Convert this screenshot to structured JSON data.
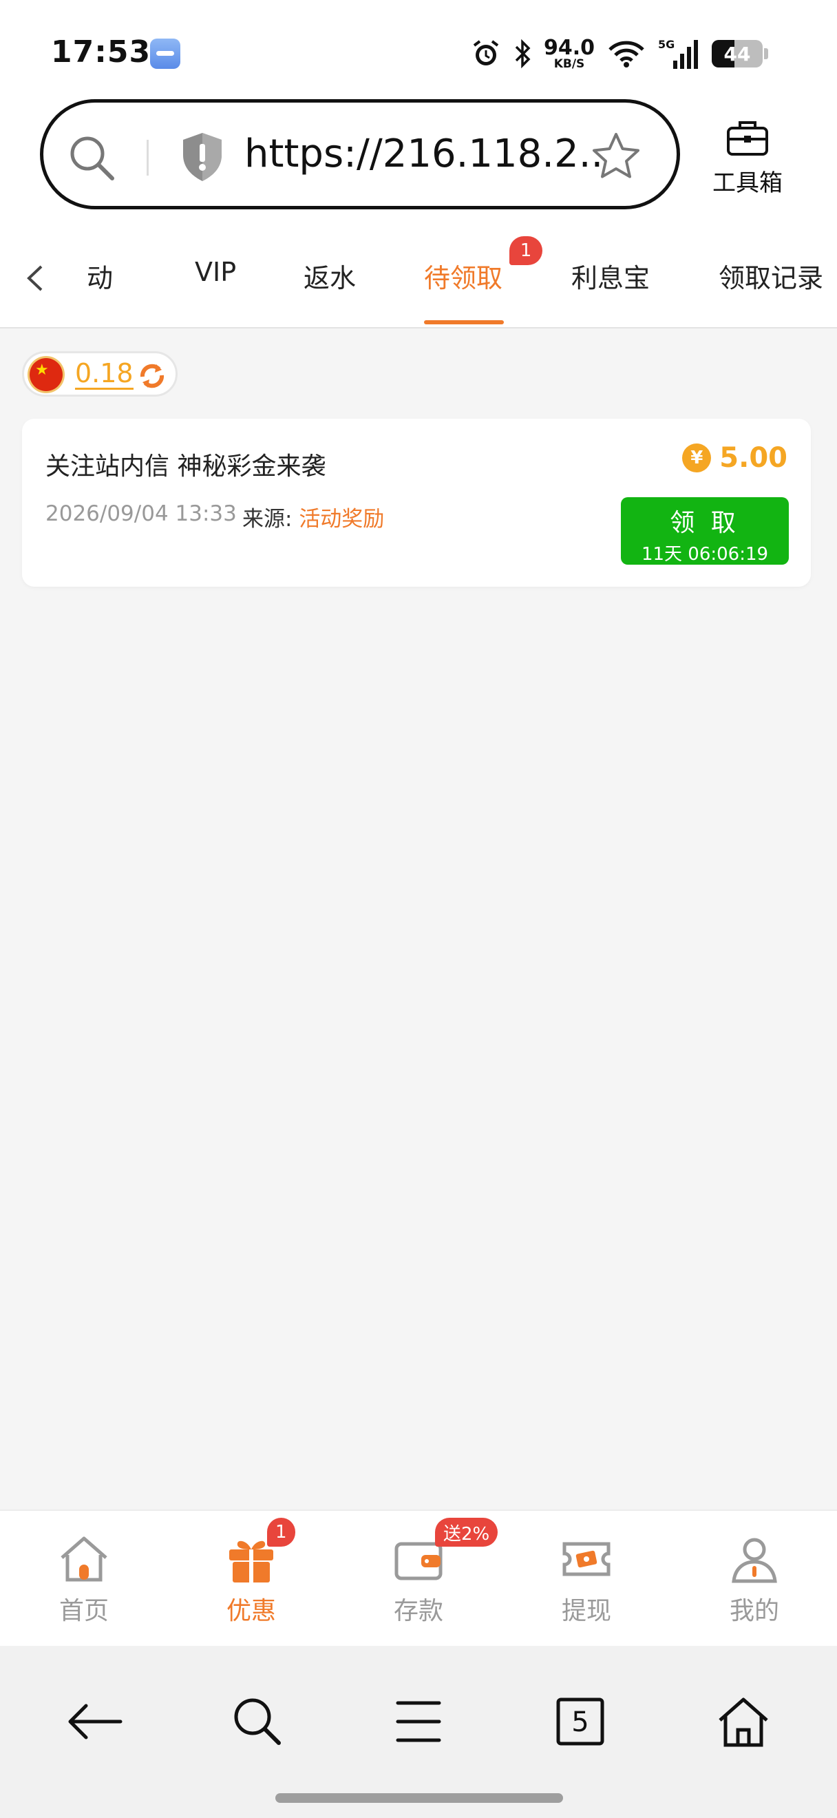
{
  "status_bar": {
    "time": "17:53",
    "net_speed_value": "94.0",
    "net_speed_unit": "KB/S",
    "network_type": "5G",
    "battery": "44",
    "battery_level": 0.44,
    "icons": [
      "alarm-icon",
      "bluetooth-icon",
      "wifi-icon",
      "signal-icon",
      "battery-icon"
    ]
  },
  "browser": {
    "url": "https://216.118.2...",
    "toolbox_label": "工具箱",
    "tab_count": "5"
  },
  "tabs": {
    "items": [
      {
        "label": "活动"
      },
      {
        "label": "VIP"
      },
      {
        "label": "返水"
      },
      {
        "label": "待领取",
        "active": true,
        "badge": "1"
      },
      {
        "label": "利息宝"
      },
      {
        "label": "领取记录"
      }
    ]
  },
  "balance": {
    "value": "0.18"
  },
  "reward_card": {
    "title": "关注站内信 神秘彩金来袭",
    "currency_symbol": "¥",
    "amount": "5.00",
    "date": "2026/09/04 13:33",
    "source_label": "来源:",
    "source_value": "活动奖励",
    "claim_label": "领 取",
    "countdown": "11天 06:06:19"
  },
  "app_nav": {
    "items": [
      {
        "label": "首页",
        "icon": "home-icon"
      },
      {
        "label": "优惠",
        "icon": "gift-icon",
        "active": true,
        "badge": "1"
      },
      {
        "label": "存款",
        "icon": "wallet-icon",
        "badge": "送2%"
      },
      {
        "label": "提现",
        "icon": "withdraw-icon"
      },
      {
        "label": "我的",
        "icon": "profile-icon"
      }
    ]
  },
  "colors": {
    "accent": "#f07a2a",
    "gold": "#f5a623",
    "claim_green": "#12b412",
    "badge_red": "#e8453c"
  }
}
